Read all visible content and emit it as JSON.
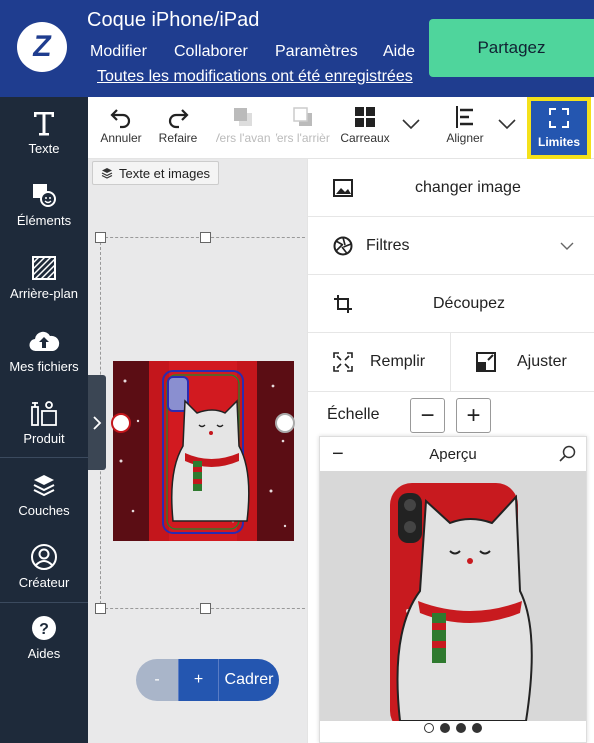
{
  "header": {
    "title": "Coque iPhone/iPad",
    "menu": [
      "Modifier",
      "Collaborer",
      "Paramètres",
      "Aide"
    ],
    "saved_text": "Toutes les modifications ont été enregistrées",
    "share_label": "Partagez",
    "logo_letter": "Z"
  },
  "rail": {
    "items": [
      {
        "label": "Texte",
        "icon": "text-icon"
      },
      {
        "label": "Éléments",
        "icon": "elements-icon"
      },
      {
        "label": "Arrière-plan",
        "icon": "background-icon"
      },
      {
        "label": "Mes fichiers",
        "icon": "cloud-upload-icon"
      },
      {
        "label": "Produit",
        "icon": "product-icon"
      },
      {
        "label": "Couches",
        "icon": "layers-icon"
      },
      {
        "label": "Créateur",
        "icon": "user-icon"
      },
      {
        "label": "Aides",
        "icon": "help-icon"
      }
    ]
  },
  "toolbar": {
    "undo": "Annuler",
    "redo": "Refaire",
    "forward": "Vers l'avant",
    "backward": "Vers l'arrière",
    "tiles": "Carreaux",
    "align": "Aligner",
    "limits": "Limites"
  },
  "canvas": {
    "layer_badge": "Texte et images",
    "zoom_minus": "-",
    "zoom_plus": "+",
    "fit_label": "Cadrer"
  },
  "panel": {
    "change_image": "changer image",
    "filters": "Filtres",
    "crop": "Découpez",
    "fill": "Remplir",
    "fit": "Ajuster",
    "scale_label": "Échelle",
    "scale_minus": "−",
    "scale_plus": "+",
    "preview_title": "Aperçu",
    "preview_collapse": "−"
  },
  "colors": {
    "header_bg": "#1f3d8f",
    "share_bg": "#4fd59c",
    "rail_bg": "#1e2a3a",
    "limits_bg": "#2456b0",
    "limits_border": "#f4e11b",
    "zoom_bg": "#2456b0",
    "zoom_disabled_bg": "#a9b5c9"
  }
}
